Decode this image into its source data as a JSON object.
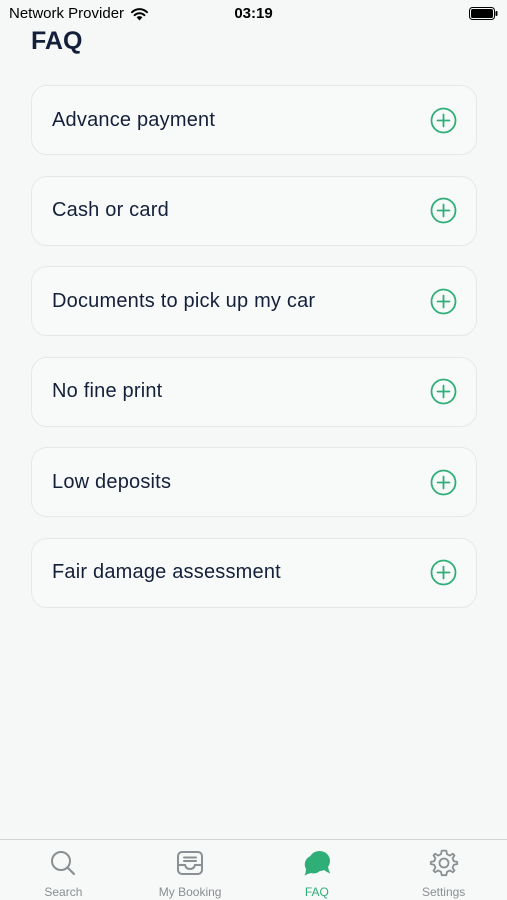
{
  "status_bar": {
    "carrier": "Network Provider",
    "time": "03:19"
  },
  "page": {
    "title": "FAQ"
  },
  "faq": {
    "items": [
      {
        "question": "Advance payment"
      },
      {
        "question": "Cash or card"
      },
      {
        "question": "Documents to pick up my car"
      },
      {
        "question": "No fine print"
      },
      {
        "question": "Low deposits"
      },
      {
        "question": "Fair damage assessment"
      }
    ]
  },
  "tab_bar": {
    "tabs": [
      {
        "label": "Search",
        "icon": "search-icon"
      },
      {
        "label": "My Booking",
        "icon": "inbox-icon"
      },
      {
        "label": "FAQ",
        "icon": "chat-bubbles-icon",
        "active": true
      },
      {
        "label": "Settings",
        "icon": "gear-icon"
      }
    ]
  },
  "colors": {
    "accent": "#2fae78",
    "text": "#14203a",
    "background": "#f6f8f8",
    "inactive_tab": "#8a8f93"
  }
}
